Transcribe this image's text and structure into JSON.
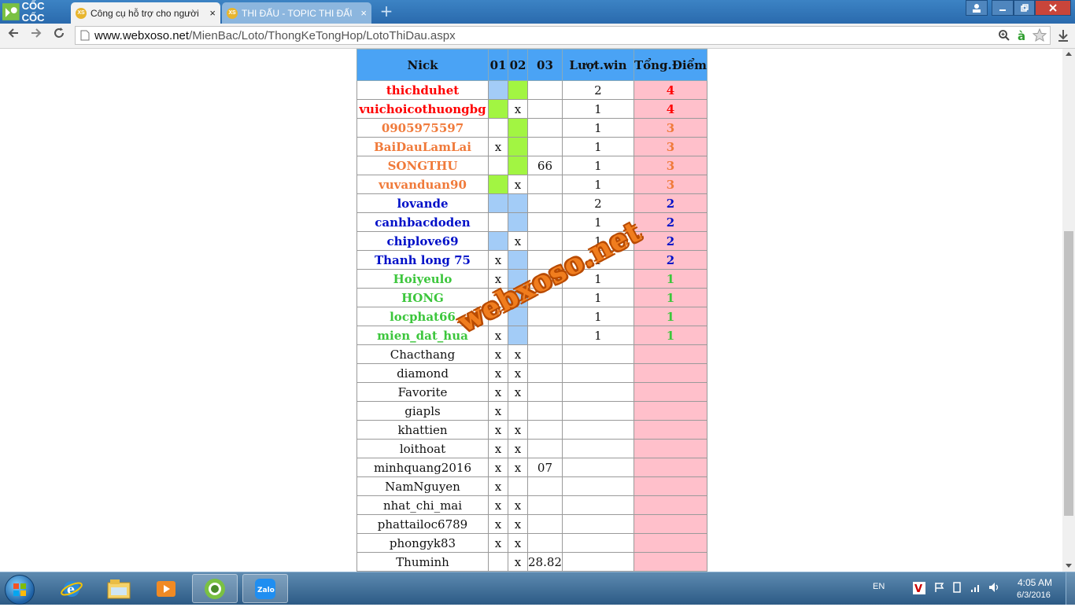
{
  "browser": {
    "brand": "CỐC CỐC",
    "tabs": [
      {
        "title": "Công cụ hỗ trợ cho người",
        "favicon": "XS",
        "active": true
      },
      {
        "title": "THI ĐẤU - TOPIC THI ĐẤU",
        "favicon": "XS",
        "active": false
      }
    ],
    "new_tab_label": "+",
    "close_label": "×",
    "url_host": "www.webxoso.net",
    "url_path": "/MienBac/Loto/ThongKeTongHop/LotoThiDau.aspx"
  },
  "table": {
    "headers": [
      "Nick",
      "01",
      "02",
      "03",
      "Lượt.win",
      "Tổng.Điểm"
    ],
    "rows": [
      {
        "nick": "thichduhet",
        "c1": "",
        "c2": "",
        "c3": "",
        "win": "2",
        "pts": "4",
        "tier": "t4",
        "c1bg": "blue",
        "c2bg": "green",
        "c3bg": ""
      },
      {
        "nick": "vuichoicothuongbg",
        "c1": "",
        "c2": "x",
        "c3": "",
        "win": "1",
        "pts": "4",
        "tier": "t4",
        "c1bg": "green",
        "c2bg": "",
        "c3bg": ""
      },
      {
        "nick": "0905975597",
        "c1": "",
        "c2": "",
        "c3": "",
        "win": "1",
        "pts": "3",
        "tier": "t3",
        "c1bg": "",
        "c2bg": "green",
        "c3bg": ""
      },
      {
        "nick": "BaiDauLamLai",
        "c1": "x",
        "c2": "",
        "c3": "",
        "win": "1",
        "pts": "3",
        "tier": "t3",
        "c1bg": "",
        "c2bg": "green",
        "c3bg": ""
      },
      {
        "nick": "SONGTHU",
        "c1": "",
        "c2": "",
        "c3": "66",
        "win": "1",
        "pts": "3",
        "tier": "t3",
        "c1bg": "",
        "c2bg": "green",
        "c3bg": ""
      },
      {
        "nick": "vuvanduan90",
        "c1": "",
        "c2": "x",
        "c3": "",
        "win": "1",
        "pts": "3",
        "tier": "t3",
        "c1bg": "green",
        "c2bg": "",
        "c3bg": ""
      },
      {
        "nick": "lovande",
        "c1": "",
        "c2": "",
        "c3": "",
        "win": "2",
        "pts": "2",
        "tier": "t2",
        "c1bg": "blue",
        "c2bg": "blue",
        "c3bg": ""
      },
      {
        "nick": "canhbacdoden",
        "c1": "",
        "c2": "",
        "c3": "",
        "win": "1",
        "pts": "2",
        "tier": "t2",
        "c1bg": "",
        "c2bg": "blue",
        "c3bg": ""
      },
      {
        "nick": "chiplove69",
        "c1": "",
        "c2": "x",
        "c3": "",
        "win": "1",
        "pts": "2",
        "tier": "t2",
        "c1bg": "blue",
        "c2bg": "",
        "c3bg": ""
      },
      {
        "nick": "Thanh long 75",
        "c1": "x",
        "c2": "",
        "c3": "",
        "win": "1",
        "pts": "2",
        "tier": "t2",
        "c1bg": "",
        "c2bg": "blue",
        "c3bg": ""
      },
      {
        "nick": "Hoiyeulo",
        "c1": "x",
        "c2": "",
        "c3": "",
        "win": "1",
        "pts": "1",
        "tier": "t1",
        "c1bg": "",
        "c2bg": "blue",
        "c3bg": ""
      },
      {
        "nick": "HONG",
        "c1": "",
        "c2": "",
        "c3": "",
        "win": "1",
        "pts": "1",
        "tier": "t1",
        "c1bg": "",
        "c2bg": "blue",
        "c3bg": ""
      },
      {
        "nick": "locphat66",
        "c1": "",
        "c2": "",
        "c3": "",
        "win": "1",
        "pts": "1",
        "tier": "t1",
        "c1bg": "",
        "c2bg": "blue",
        "c3bg": ""
      },
      {
        "nick": "mien_dat_hua",
        "c1": "x",
        "c2": "",
        "c3": "",
        "win": "1",
        "pts": "1",
        "tier": "t1",
        "c1bg": "",
        "c2bg": "blue",
        "c3bg": ""
      },
      {
        "nick": "Chacthang",
        "c1": "x",
        "c2": "x",
        "c3": "",
        "win": "",
        "pts": "",
        "tier": "",
        "c1bg": "",
        "c2bg": "",
        "c3bg": ""
      },
      {
        "nick": "diamond",
        "c1": "x",
        "c2": "x",
        "c3": "",
        "win": "",
        "pts": "",
        "tier": "",
        "c1bg": "",
        "c2bg": "",
        "c3bg": ""
      },
      {
        "nick": "Favorite",
        "c1": "x",
        "c2": "x",
        "c3": "",
        "win": "",
        "pts": "",
        "tier": "",
        "c1bg": "",
        "c2bg": "",
        "c3bg": ""
      },
      {
        "nick": "giapls",
        "c1": "x",
        "c2": "",
        "c3": "",
        "win": "",
        "pts": "",
        "tier": "",
        "c1bg": "",
        "c2bg": "",
        "c3bg": ""
      },
      {
        "nick": "khattien",
        "c1": "x",
        "c2": "x",
        "c3": "",
        "win": "",
        "pts": "",
        "tier": "",
        "c1bg": "",
        "c2bg": "",
        "c3bg": ""
      },
      {
        "nick": "loithoat",
        "c1": "x",
        "c2": "x",
        "c3": "",
        "win": "",
        "pts": "",
        "tier": "",
        "c1bg": "",
        "c2bg": "",
        "c3bg": ""
      },
      {
        "nick": "minhquang2016",
        "c1": "x",
        "c2": "x",
        "c3": "07",
        "win": "",
        "pts": "",
        "tier": "",
        "c1bg": "",
        "c2bg": "",
        "c3bg": ""
      },
      {
        "nick": "NamNguyen",
        "c1": "x",
        "c2": "",
        "c3": "",
        "win": "",
        "pts": "",
        "tier": "",
        "c1bg": "",
        "c2bg": "",
        "c3bg": ""
      },
      {
        "nick": "nhat_chi_mai",
        "c1": "x",
        "c2": "x",
        "c3": "",
        "win": "",
        "pts": "",
        "tier": "",
        "c1bg": "",
        "c2bg": "",
        "c3bg": ""
      },
      {
        "nick": "phattailoc6789",
        "c1": "x",
        "c2": "x",
        "c3": "",
        "win": "",
        "pts": "",
        "tier": "",
        "c1bg": "",
        "c2bg": "",
        "c3bg": ""
      },
      {
        "nick": "phongyk83",
        "c1": "x",
        "c2": "x",
        "c3": "",
        "win": "",
        "pts": "",
        "tier": "",
        "c1bg": "",
        "c2bg": "",
        "c3bg": ""
      },
      {
        "nick": "Thuminh",
        "c1": "",
        "c2": "x",
        "c3": "28.82",
        "win": "",
        "pts": "",
        "tier": "",
        "c1bg": "",
        "c2bg": "",
        "c3bg": ""
      }
    ]
  },
  "watermark": "webxoso.net",
  "taskbar": {
    "lang": "EN",
    "time": "4:05 AM",
    "date": "6/3/2016",
    "apps": [
      "internet-explorer",
      "file-explorer",
      "media-player",
      "coccoc-browser",
      "zalo"
    ],
    "zalo_label": "Zalo"
  },
  "colors": {
    "header_blue": "#4aa3f5",
    "points_pink": "#ffc0cb",
    "cell_blue": "#a3ccf7",
    "cell_green": "#a2f542"
  }
}
